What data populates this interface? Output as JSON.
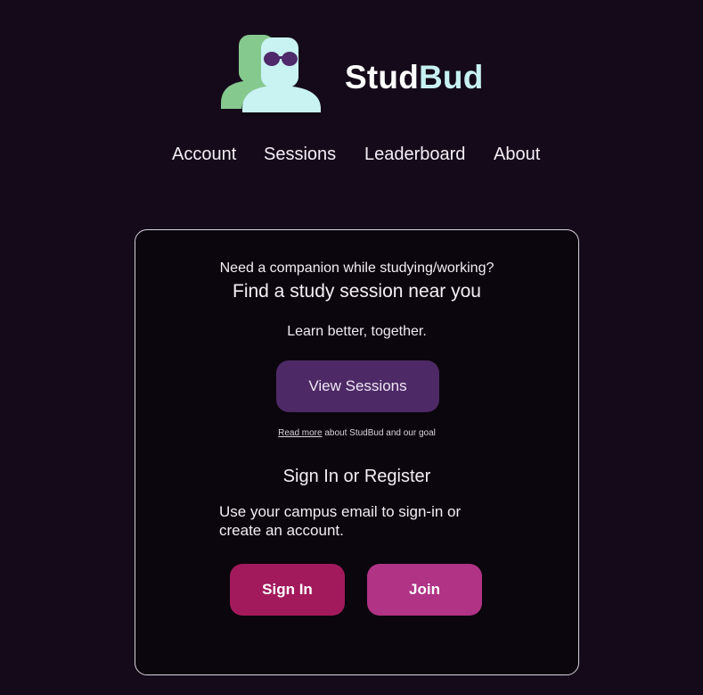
{
  "brand": {
    "name_part1": "Stud",
    "name_part2": "Bud",
    "logo_icon": "two-people-sunglasses-logo"
  },
  "nav": {
    "items": [
      {
        "label": "Account"
      },
      {
        "label": "Sessions"
      },
      {
        "label": "Leaderboard"
      },
      {
        "label": "About"
      }
    ]
  },
  "card": {
    "companion_text": "Need a companion while studying/working?",
    "find_text": "Find a study session near you",
    "learn_text": "Learn better, together.",
    "view_sessions_label": "View Sessions",
    "read_more_link": "Read more",
    "read_more_rest": " about StudBud and our goal",
    "signin_title": "Sign In or Register",
    "campus_text": "Use your campus email to sign-in or create an account.",
    "signin_label": "Sign In",
    "join_label": "Join"
  },
  "colors": {
    "background": "#150a1a",
    "card_background": "#0b060d",
    "view_sessions_button": "#4d2965",
    "signin_button": "#a21a5c",
    "join_button": "#b03386",
    "brand_accent": "#c7f1f3",
    "logo_green": "#86c98f"
  }
}
